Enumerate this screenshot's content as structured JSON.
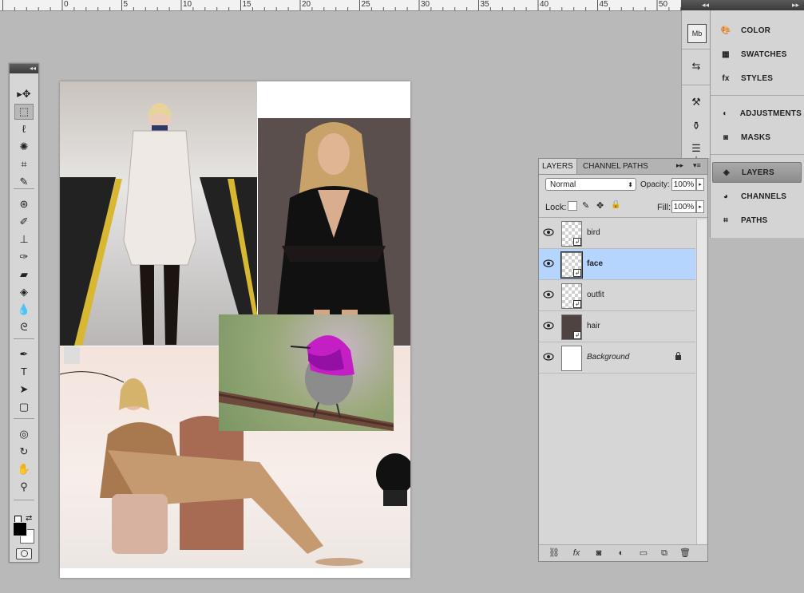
{
  "ruler": {
    "labels": [
      "0",
      "5",
      "10",
      "15",
      "20",
      "25",
      "30",
      "35",
      "40",
      "45",
      "50"
    ]
  },
  "tools": [
    {
      "name": "move-tool",
      "glyph": "▸✥"
    },
    {
      "name": "marquee-tool",
      "glyph": "⬚"
    },
    {
      "name": "lasso-tool",
      "glyph": "ℓ"
    },
    {
      "name": "quick-selection-tool",
      "glyph": "✺"
    },
    {
      "name": "crop-tool",
      "glyph": "⌗"
    },
    {
      "name": "eyedropper-tool",
      "glyph": "✎"
    },
    {
      "name": "spot-healing-tool",
      "glyph": "⊛"
    },
    {
      "name": "brush-tool",
      "glyph": "✐"
    },
    {
      "name": "clone-stamp-tool",
      "glyph": "⊥"
    },
    {
      "name": "history-brush-tool",
      "glyph": "✑"
    },
    {
      "name": "eraser-tool",
      "glyph": "▰"
    },
    {
      "name": "paint-bucket-tool",
      "glyph": "◈"
    },
    {
      "name": "blur-tool",
      "glyph": "💧"
    },
    {
      "name": "dodge-tool",
      "glyph": "ᘓ"
    },
    {
      "name": "pen-tool",
      "glyph": "✒"
    },
    {
      "name": "type-tool",
      "glyph": "T"
    },
    {
      "name": "path-selection-tool",
      "glyph": "➤"
    },
    {
      "name": "rectangle-tool",
      "glyph": "▢"
    },
    {
      "name": "3d-rotate-tool",
      "glyph": "◎"
    },
    {
      "name": "3d-orbit-tool",
      "glyph": "↻"
    },
    {
      "name": "hand-tool",
      "glyph": "✋"
    },
    {
      "name": "zoom-tool",
      "glyph": "⚲"
    }
  ],
  "swatches": {
    "foreground": "#000000",
    "background": "#ffffff"
  },
  "dock": {
    "panels": [
      {
        "id": "color",
        "label": "COLOR"
      },
      {
        "id": "swatches",
        "label": "SWATCHES"
      },
      {
        "id": "styles",
        "label": "STYLES"
      },
      {
        "id": "adjustments",
        "label": "ADJUSTMENTS"
      },
      {
        "id": "masks",
        "label": "MASKS"
      },
      {
        "id": "layers",
        "label": "LAYERS"
      },
      {
        "id": "channels",
        "label": "CHANNELS"
      },
      {
        "id": "paths",
        "label": "PATHS"
      }
    ],
    "icons": [
      {
        "id": "mini-bridge",
        "glyph": "Mb"
      },
      {
        "id": "history",
        "glyph": "⇆"
      },
      {
        "id": "tool-presets",
        "glyph": "⚒"
      },
      {
        "id": "clone-source",
        "glyph": "⚱"
      },
      {
        "id": "brush-presets",
        "glyph": "☰"
      },
      {
        "id": "actions",
        "glyph": "⊥"
      }
    ]
  },
  "layers_panel": {
    "tabs": [
      "LAYERS",
      "CHANNEL",
      "PATHS"
    ],
    "blend_mode": "Normal",
    "opacity_label": "Opacity:",
    "opacity": "100%",
    "lock_label": "Lock:",
    "fill_label": "Fill:",
    "fill": "100%",
    "layers": [
      {
        "name": "bird",
        "visible": true,
        "selected": false,
        "smart": true
      },
      {
        "name": "face",
        "visible": true,
        "selected": true,
        "smart": true
      },
      {
        "name": "outfit",
        "visible": true,
        "selected": false,
        "smart": true
      },
      {
        "name": "hair",
        "visible": true,
        "selected": false,
        "smart": true
      },
      {
        "name": "Background",
        "visible": true,
        "selected": false,
        "locked": true
      }
    ]
  },
  "colors": {
    "selection": "#b5d5ff",
    "workspace": "#b9b9b9"
  }
}
